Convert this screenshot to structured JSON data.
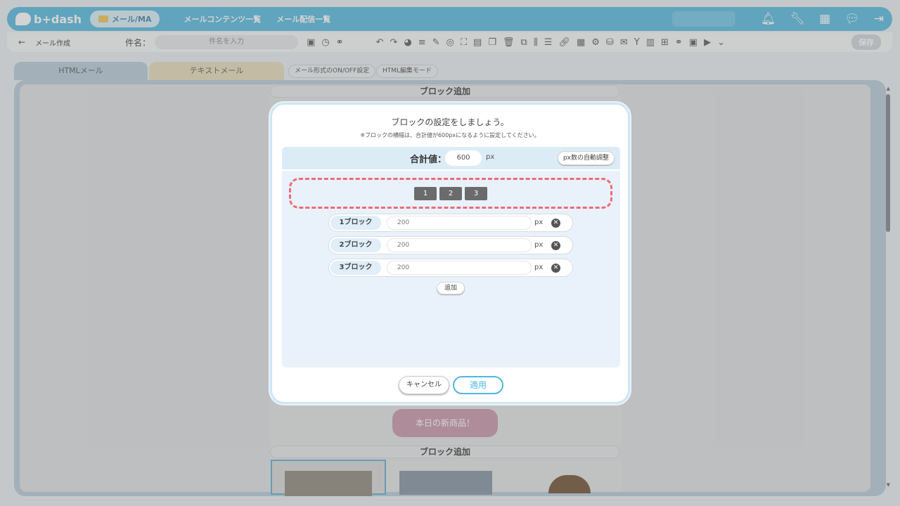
{
  "header": {
    "logo": "b+dash",
    "module_pill": "メール/MA",
    "nav": [
      "メールコンテンツ一覧",
      "メール配信一覧"
    ],
    "icons": [
      "bell-icon",
      "wrench-icon",
      "grid-icon",
      "chat-icon",
      "logout-icon"
    ]
  },
  "toolbar": {
    "back": "←",
    "breadcrumb": "メール作成",
    "subject_label": "件名：",
    "subject_placeholder": "件名を入力",
    "save_label": "保存"
  },
  "tabs": {
    "html": "HTMLメール",
    "text": "テキストメール",
    "onoff": "メール形式のON/OFF設定",
    "html_edit": "HTML編集モード"
  },
  "editor": {
    "add_block": "ブロック追加",
    "add_block_2": "ブロック追加",
    "new_product_button": "本日の新商品！"
  },
  "modal": {
    "title": "ブロックの設定をしましょう。",
    "note": "※ブロックの横幅は、合計値が600pxになるように設定してください。",
    "total_label": "合計値：",
    "total_value": "600",
    "total_unit": "px",
    "auto_adjust": "px数の自動調整",
    "layout_buttons": [
      "1",
      "2",
      "3"
    ],
    "blocks": [
      {
        "label": "1ブロック",
        "value": "200",
        "unit": "px"
      },
      {
        "label": "2ブロック",
        "value": "200",
        "unit": "px"
      },
      {
        "label": "3ブロック",
        "value": "200",
        "unit": "px"
      }
    ],
    "add_label": "追加",
    "cancel_label": "キャンセル",
    "apply_label": "適用"
  },
  "colors": {
    "brand": "#4fb7de",
    "highlight": "#ee6b77"
  }
}
